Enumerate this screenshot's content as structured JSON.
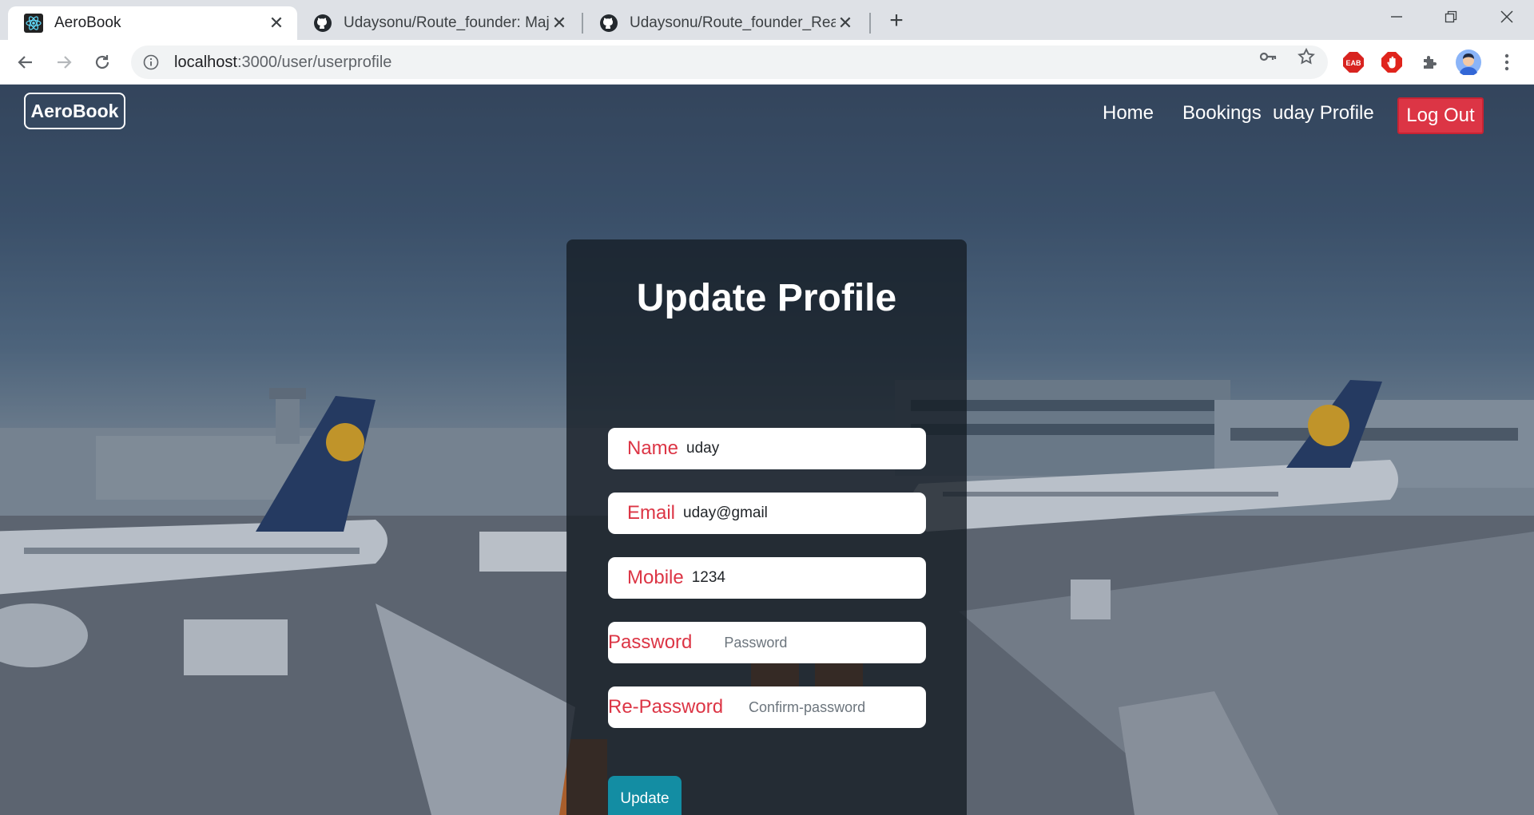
{
  "browser": {
    "tabs": [
      {
        "title": "AeroBook",
        "active": true
      },
      {
        "title": "Udaysonu/Route_founder: Major",
        "active": false
      },
      {
        "title": "Udaysonu/Route_founder_React_",
        "active": false
      }
    ],
    "url_host": "localhost",
    "url_path": ":3000/user/userprofile"
  },
  "site": {
    "brand": "AeroBook",
    "nav": {
      "home": "Home",
      "bookings": "Bookings",
      "profile": "uday Profile",
      "logout": "Log Out"
    }
  },
  "form": {
    "title": "Update Profile",
    "name_label": "Name",
    "name_value": "uday",
    "email_label": "Email",
    "email_value": "uday@gmail",
    "mobile_label": "Mobile",
    "mobile_value": "1234",
    "password_label": "Password",
    "password_placeholder": "Password",
    "repassword_label": "Re-Password",
    "repassword_placeholder": "Confirm-password",
    "submit": "Update"
  },
  "colors": {
    "accent_red": "#dc3545",
    "button_teal": "#138da3"
  }
}
